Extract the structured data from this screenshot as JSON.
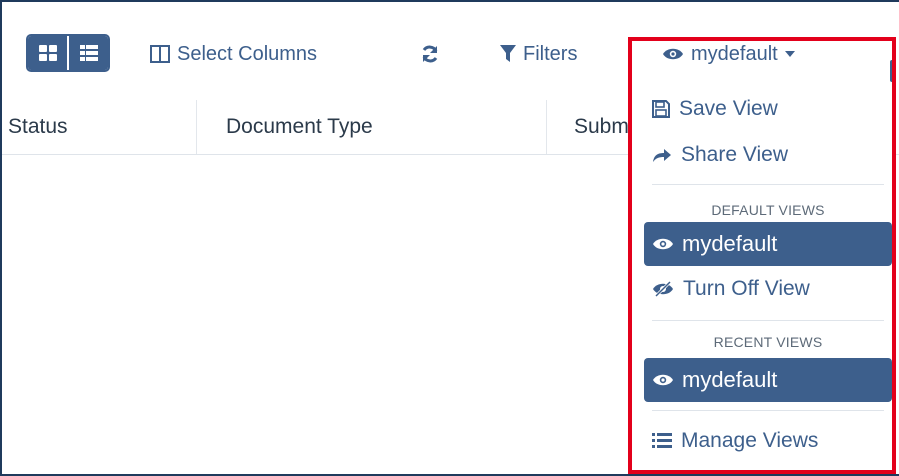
{
  "toolbar": {
    "view_toggle": [
      "grid-view-icon",
      "list-view-icon"
    ],
    "select_columns_label": "Select Columns",
    "refresh_icon": "refresh-icon",
    "filters_label": "Filters",
    "current_view_label": "mydefault"
  },
  "table": {
    "columns": [
      "Status",
      "Document Type",
      "Subm"
    ]
  },
  "view_menu": {
    "save_view_label": "Save View",
    "share_view_label": "Share View",
    "default_views_header": "DEFAULT VIEWS",
    "default_views": [
      "mydefault"
    ],
    "turn_off_view_label": "Turn Off View",
    "recent_views_header": "RECENT VIEWS",
    "recent_views": [
      "mydefault"
    ],
    "manage_views_label": "Manage Views"
  },
  "colors": {
    "accent": "#3d5f8c",
    "highlight": "#e3001b"
  }
}
